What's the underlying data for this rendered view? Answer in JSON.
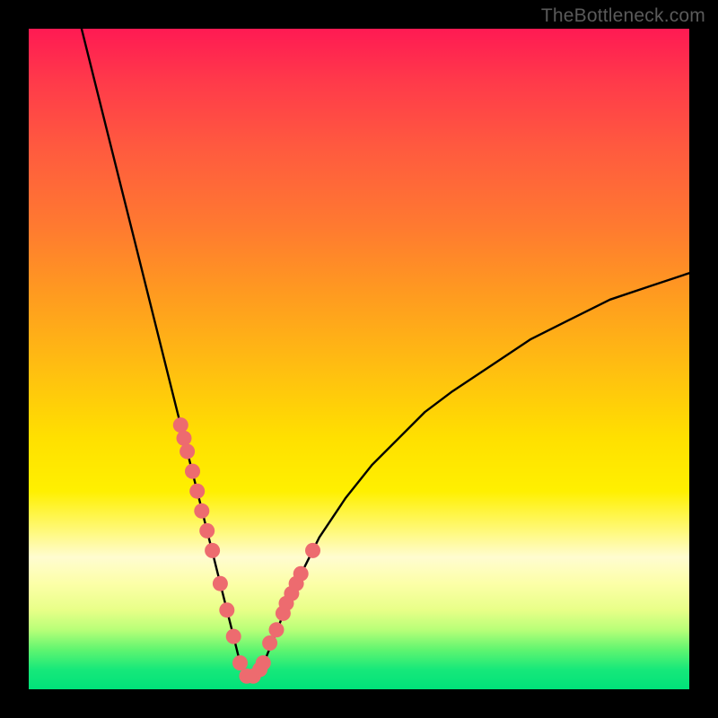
{
  "watermark": "TheBottleneck.com",
  "colors": {
    "frame_border": "#000000",
    "curve": "#000000",
    "marker_fill": "#ed6b6f",
    "marker_stroke": "#d95a5e",
    "gradient_top": "#ff1a53",
    "gradient_bottom": "#00e27a"
  },
  "chart_data": {
    "type": "line",
    "title": "",
    "xlabel": "",
    "ylabel": "",
    "xlim": [
      0,
      100
    ],
    "ylim": [
      0,
      100
    ],
    "description": "Bottleneck curve: a V-shaped curve over a vertical red→yellow→green gradient. The left branch descends steeply from the top-left, the minimum (near-zero bottleneck) sits at roughly x≈33 at the green band, and the right branch rises with decreasing slope toward x=100 reaching about 60% of full height. Salmon-colored dots cluster along both branches near the trough.",
    "series": [
      {
        "name": "curve",
        "x": [
          8,
          10,
          12,
          14,
          16,
          18,
          20,
          22,
          24,
          26,
          27,
          28,
          29,
          30,
          31,
          32,
          33,
          34,
          35,
          36,
          38,
          40,
          42,
          44,
          48,
          52,
          56,
          60,
          64,
          70,
          76,
          82,
          88,
          94,
          100
        ],
        "y": [
          100,
          92,
          84,
          76,
          68,
          60,
          52,
          44,
          36,
          28,
          24,
          20,
          16,
          12,
          8,
          4,
          2,
          2,
          3,
          5,
          10,
          15,
          19,
          23,
          29,
          34,
          38,
          42,
          45,
          49,
          53,
          56,
          59,
          61,
          63
        ]
      }
    ],
    "markers": {
      "name": "data-points",
      "x": [
        23.0,
        23.5,
        24.0,
        24.8,
        25.5,
        26.2,
        27.0,
        27.8,
        29.0,
        30.0,
        31.0,
        32.0,
        33.0,
        34.0,
        35.0,
        35.5,
        36.5,
        37.5,
        38.5,
        39.0,
        39.8,
        40.5,
        41.2,
        43.0
      ],
      "y": [
        40.0,
        38.0,
        36.0,
        33.0,
        30.0,
        27.0,
        24.0,
        21.0,
        16.0,
        12.0,
        8.0,
        4.0,
        2.0,
        2.0,
        3.0,
        4.0,
        7.0,
        9.0,
        11.5,
        13.0,
        14.5,
        16.0,
        17.5,
        21.0
      ]
    }
  }
}
